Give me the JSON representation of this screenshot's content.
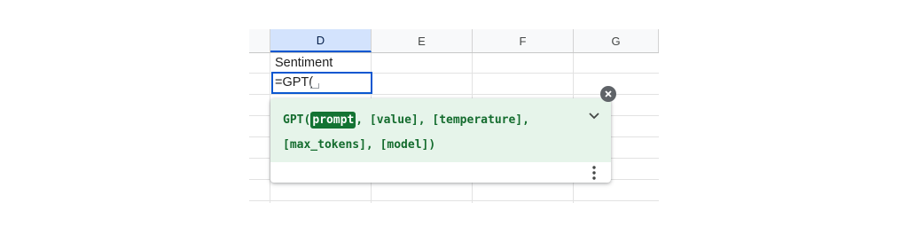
{
  "columns": [
    "D",
    "E",
    "F",
    "G"
  ],
  "cells": {
    "D1": "Sentiment",
    "D2_formula": "=GPT("
  },
  "formula_help": {
    "function_name": "GPT(",
    "active_param": "prompt",
    "line1_rest": ", [value], [temperature],",
    "line2": "[max_tokens], [model])"
  },
  "icons": {
    "close": "close-icon",
    "expand": "chevron-down-icon",
    "more": "more-vert-icon",
    "caret": "space-caret-icon"
  },
  "colors": {
    "accent": "#0b57d0",
    "help_bg": "#e6f4ea",
    "help_text": "#146c2e",
    "highlight": "#137333"
  }
}
